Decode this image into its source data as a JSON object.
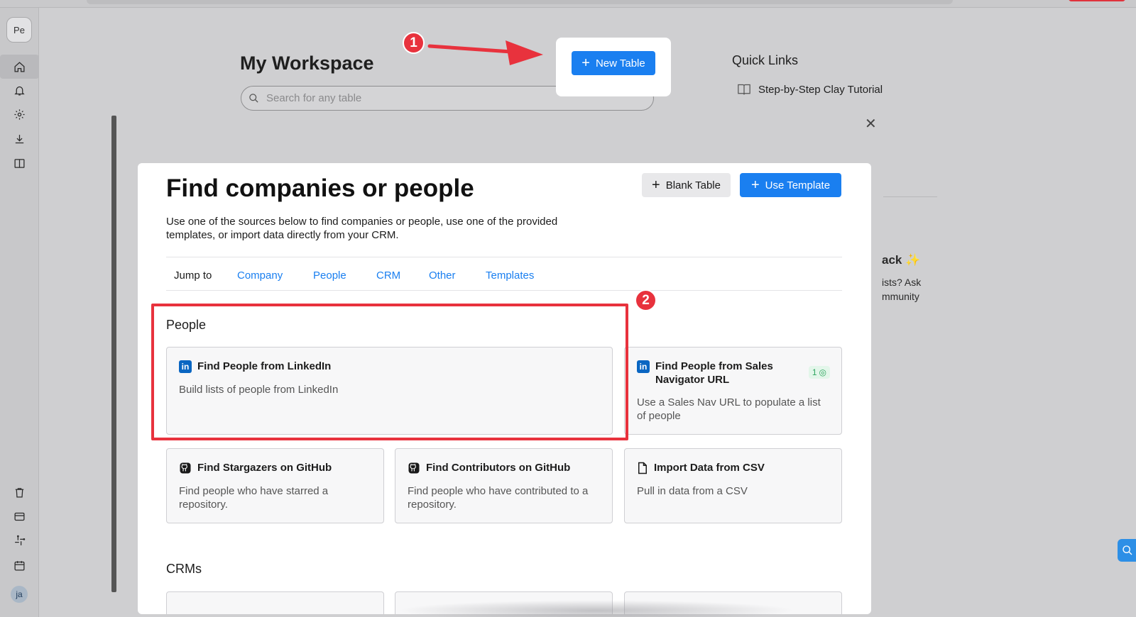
{
  "sidebar": {
    "avatar_top": "Pe",
    "avatar_bottom": "ja",
    "nav_icons": [
      "home-icon",
      "bell-icon",
      "gear-icon",
      "download-icon",
      "book-icon",
      "trash-icon",
      "card-icon",
      "slack-icon",
      "calendar-icon"
    ]
  },
  "workspace": {
    "title": "My Workspace",
    "search_placeholder": "Search for any table",
    "new_table_label": "New Table"
  },
  "markers": {
    "one": "1",
    "two": "2"
  },
  "quick_links": {
    "title": "Quick Links",
    "items": [
      {
        "label": "Step-by-Step Clay Tutorial",
        "icon": "book-open-icon"
      }
    ]
  },
  "side_card": {
    "title": "ack",
    "sparkle": "✨",
    "line1": "ists? Ask",
    "line2": "mmunity"
  },
  "modal": {
    "title": "Find companies or people",
    "description": "Use one of the sources below to find companies or people, use one of the provided templates, or import data directly from your CRM.",
    "blank_table_label": "Blank Table",
    "use_template_label": "Use Template",
    "jump_to_label": "Jump to",
    "jump_links": [
      "Company",
      "People",
      "CRM",
      "Other",
      "Templates"
    ],
    "people_section_title": "People",
    "crms_section_title": "CRMs",
    "cards": [
      {
        "title": "Find People from LinkedIn",
        "description": "Build lists of people from LinkedIn",
        "icon": "linkedin-icon"
      },
      {
        "title": "Find People from Sales Navigator URL",
        "description": "Use a Sales Nav URL to populate a list of people",
        "icon": "linkedin-icon",
        "credits": "1"
      },
      {
        "title": "Find Stargazers on GitHub",
        "description": "Find people who have starred a repository.",
        "icon": "github-icon"
      },
      {
        "title": "Find Contributors on GitHub",
        "description": "Find people who have contributed to a repository.",
        "icon": "github-icon"
      },
      {
        "title": "Import Data from CSV",
        "description": "Pull in data from a CSV",
        "icon": "file-icon"
      }
    ]
  },
  "colors": {
    "accent": "#1a7ff0",
    "highlight": "#e8323d",
    "linkedin": "#0a66c2"
  }
}
